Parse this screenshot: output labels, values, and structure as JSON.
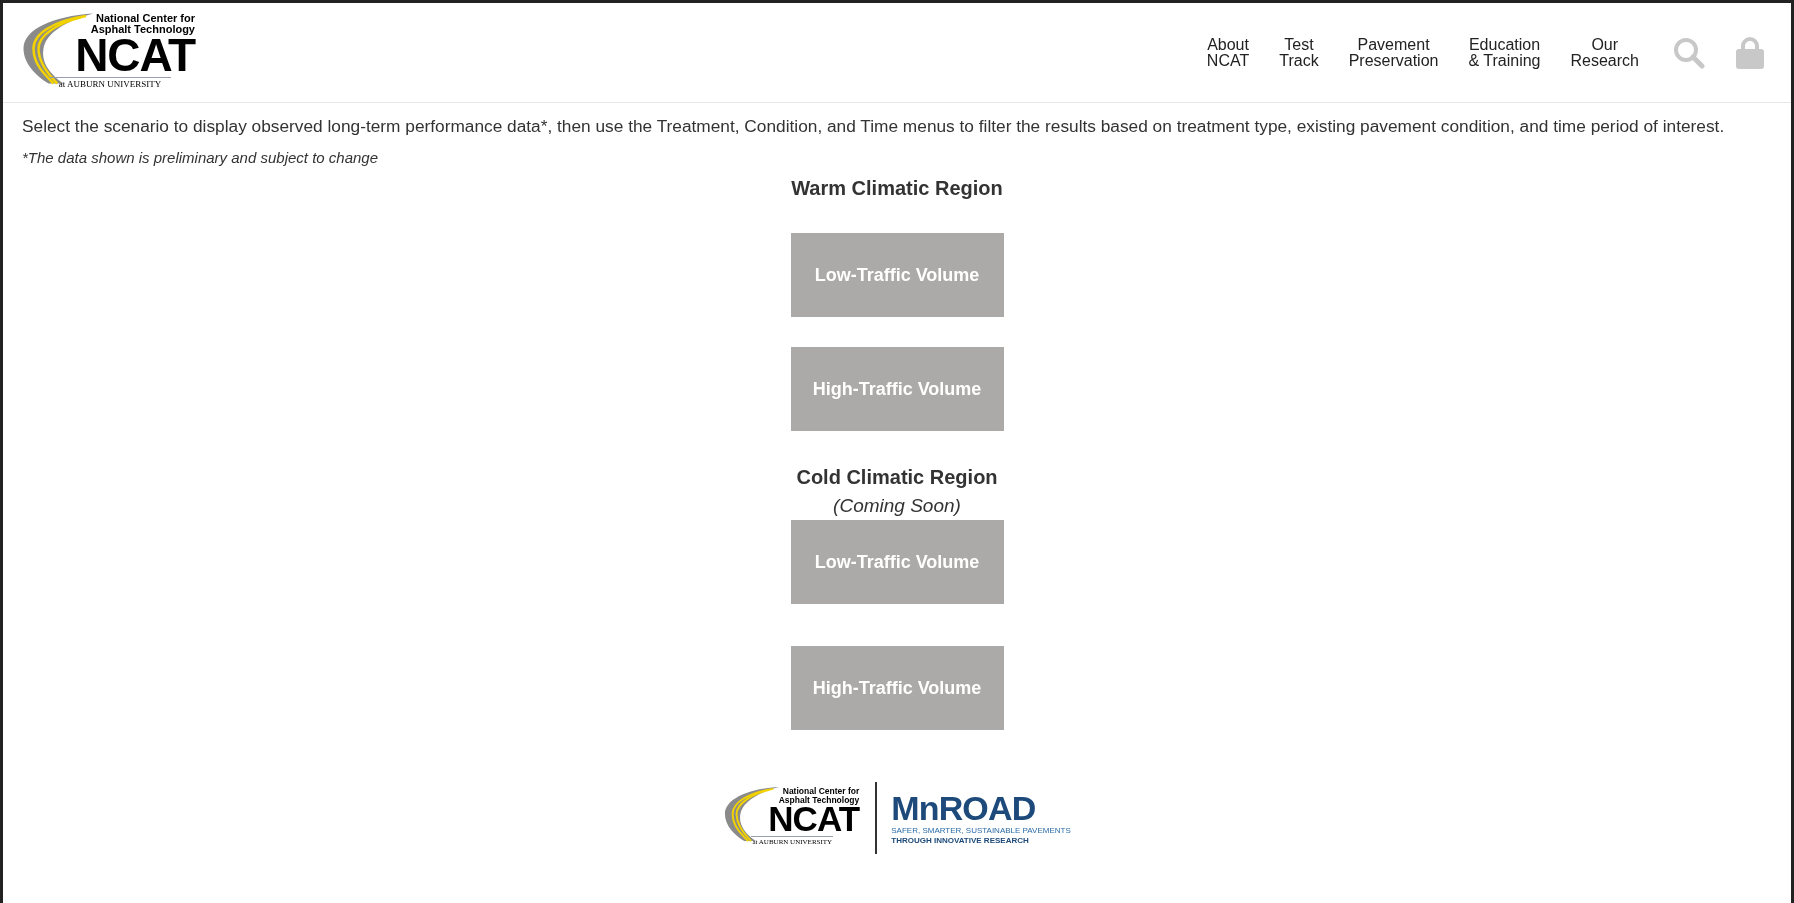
{
  "header": {
    "logo": {
      "line_1": "National Center for",
      "line_2": "Asphalt Technology",
      "wordmark": "NCAT",
      "subline": "at AUBURN UNIVERSITY"
    },
    "nav": [
      {
        "line_1": "About",
        "line_2": "NCAT"
      },
      {
        "line_1": "Test",
        "line_2": "Track"
      },
      {
        "line_1": "Pavement",
        "line_2": "Preservation"
      },
      {
        "line_1": "Education",
        "line_2": "& Training"
      },
      {
        "line_1": "Our",
        "line_2": "Research"
      }
    ]
  },
  "intro": "Select the scenario to display observed long-term performance data*, then use the Treatment, Condition, and Time menus to filter the results based on treatment type, existing pavement condition, and time period of interest.",
  "note": "*The data shown is preliminary and subject to change",
  "regions": [
    {
      "title": "Warm Climatic Region",
      "buttons": [
        "Low-Traffic Volume",
        "High-Traffic Volume"
      ]
    },
    {
      "title": "Cold Climatic Region",
      "subtitle": "(Coming Soon)",
      "buttons": [
        "Low-Traffic Volume",
        "High-Traffic Volume"
      ]
    }
  ],
  "footer": {
    "ncat": {
      "line_1": "National Center for",
      "line_2": "Asphalt Technology",
      "wordmark": "NCAT",
      "subline": "at AUBURN UNIVERSITY"
    },
    "mnroad": {
      "wordmark": "MnROAD",
      "tagline_1": "SAFER, SMARTER, SUSTAINABLE PAVEMENTS",
      "tagline_2": "THROUGH INNOVATIVE RESEARCH"
    }
  }
}
